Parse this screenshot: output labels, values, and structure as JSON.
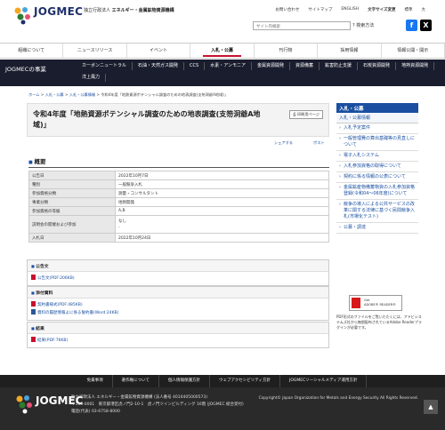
{
  "header": {
    "logo_text": "JOGMEC",
    "tagline_prefix": "独立行政法人",
    "tagline_main": "エネルギー・金属鉱物資源機構",
    "top_links": [
      "お問い合わせ",
      "サイトマップ",
      "ENGLISH",
      "文字サイズ変更",
      "標準",
      "大"
    ],
    "search_placeholder": "サイト内検索",
    "search_button": "検索方法"
  },
  "global_nav": [
    "組織について",
    "ニュースリリース",
    "イベント",
    "入札・公募",
    "刊行物",
    "採用情報",
    "情報公開・開示"
  ],
  "global_nav_active_index": 3,
  "subnav": {
    "title": "JOGMECの事業",
    "items": [
      "カーボンニュートラル",
      "石油・天然ガス開発",
      "CCS",
      "水素・アンモニア",
      "金属資源開発",
      "資源備蓄",
      "鉱害防止支援",
      "石炭資源開発",
      "地熱資源開発",
      "洋上風力"
    ]
  },
  "breadcrumb": {
    "home": "ホーム",
    "sep": ">",
    "level1": "入札・公募",
    "level2": "入札・公募情報",
    "current": "令和4年度「地熱資源ポテンシャル調査のための地表調査(支笏洞爺A地域)」"
  },
  "page": {
    "title": "令和4年度「地熱資源ポテンシャル調査のための地表調査(支笏洞爺A地域)」",
    "print_button": "印刷用ページ",
    "share_a": "シェアする",
    "share_b": "ポスト",
    "section_overview": "概要",
    "overview_rows": [
      {
        "key": "公告日",
        "value": "2022年10月7日"
      },
      {
        "key": "種別",
        "value": "一般競争入札"
      },
      {
        "key": "参加資格分類",
        "value": "測量・コンサルタント"
      },
      {
        "key": "事業分類",
        "value": "地熱開発"
      },
      {
        "key": "参加資格の等級",
        "value": "A,B"
      },
      {
        "key": "説明会の開催および参加",
        "value": "なし\n-"
      },
      {
        "key": "入札日",
        "value": "2022年10月24日"
      }
    ],
    "koukoku": {
      "heading": "公告文",
      "files": [
        "公告文(PDF:206KB)"
      ]
    },
    "tenpu": {
      "heading": "添付資料",
      "files": [
        "契約書様式(PDF:485KB)",
        "資料の履歴情報よに係る誓約書(Word:24KB)"
      ]
    },
    "kekka": {
      "heading": "結果",
      "files": [
        "結果(PDF:76KB)"
      ]
    }
  },
  "sidebar": {
    "heading": "入札・公募",
    "subheading": "入札・公募情報",
    "items": [
      "入札予定案件",
      "一般管理費の算出基礎等の見直しについて",
      "電子入札システム",
      "入札参加資格の取得について",
      "契約に係る情報の公表について",
      "金属鉱産物備蓄物資の入札参加資格登録(令和04〜06年度)について",
      "競争の導入による公共サービスの改革に関する法律に基づく民間競争入札(市場化テスト)",
      "公募・調達"
    ],
    "adobe_line1": "Get",
    "adobe_line2": "ADOBE® READER®",
    "adobe_note": "PDF形式のファイルをご覧いただくには、アドビシステムズ社から無償配布されているAdobe Readerプラグインが必要です。"
  },
  "footer": {
    "nav": [
      "免責事項",
      "著作権について",
      "個人情報保護方針",
      "ウェブアクセシビリティ方針",
      "JOGMECソーシャルメディア運用方針"
    ],
    "logo_text": "JOGMEC",
    "org": "独立行政法人 エネルギー・金属鉱物資源機構 (法人番号 4010405000573)",
    "address": "〒105-0001　東京都港区虎ノ門2-10-1　虎ノ門ツインビルディング 16階 (JOGMEC 総合受付)",
    "tel": "電話(代表) 03-6758-8000",
    "copyright": "Copyright© Japan Organization for Metals and Energy Security All Rights Reserved.",
    "pagetop": "▲"
  }
}
